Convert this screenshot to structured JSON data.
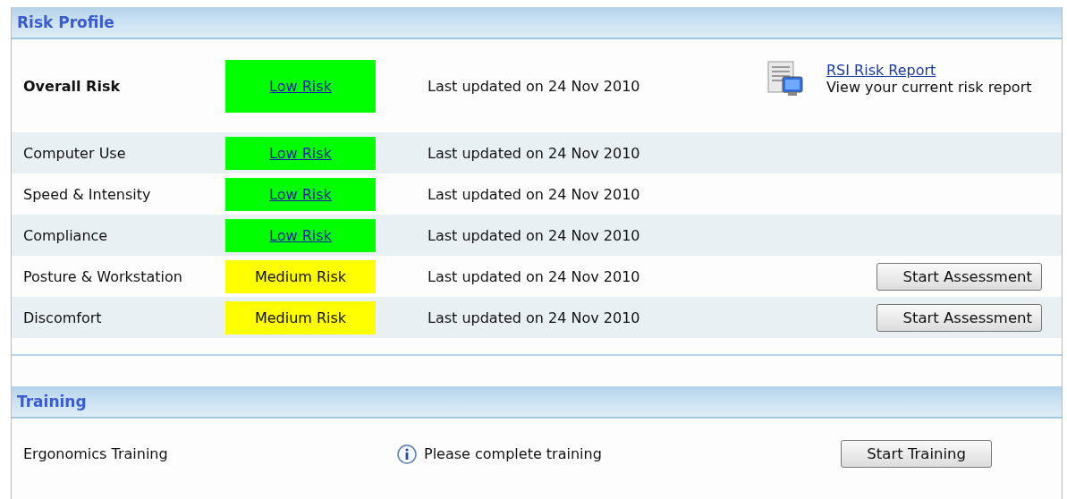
{
  "sections": [
    {
      "title": "Risk Profile",
      "rows": [
        {
          "label": "Overall Risk",
          "bold": true,
          "risk": {
            "text": "Low Risk",
            "kind": "low"
          },
          "updated": "Last updated on 24 Nov 2010",
          "action": {
            "kind": "report",
            "link": "RSI Risk Report",
            "text": "View your current risk report"
          }
        },
        {
          "label": "Computer Use",
          "bold": false,
          "risk": {
            "text": "Low Risk",
            "kind": "low"
          },
          "updated": "Last updated on 24 Nov 2010"
        },
        {
          "label": "Speed & Intensity",
          "bold": false,
          "risk": {
            "text": "Low Risk",
            "kind": "low"
          },
          "updated": "Last updated on 24 Nov 2010"
        },
        {
          "label": "Compliance",
          "bold": false,
          "risk": {
            "text": "Low Risk",
            "kind": "low"
          },
          "updated": "Last updated on 24 Nov 2010"
        },
        {
          "label": "Posture & Workstation",
          "bold": false,
          "risk": {
            "text": "Medium Risk",
            "kind": "medium"
          },
          "updated": "Last updated on 24 Nov 2010",
          "action": {
            "kind": "button",
            "text": "Start Assessment"
          }
        },
        {
          "label": "Discomfort",
          "bold": false,
          "risk": {
            "text": "Medium Risk",
            "kind": "medium"
          },
          "updated": "Last updated on 24 Nov 2010",
          "action": {
            "kind": "button",
            "text": "Start Assessment"
          }
        }
      ]
    },
    {
      "title": "Training",
      "rows": [
        {
          "label": "Ergonomics Training",
          "bold": false,
          "info": "Please complete training",
          "action": {
            "kind": "button",
            "text": "Start Training"
          }
        }
      ]
    }
  ]
}
